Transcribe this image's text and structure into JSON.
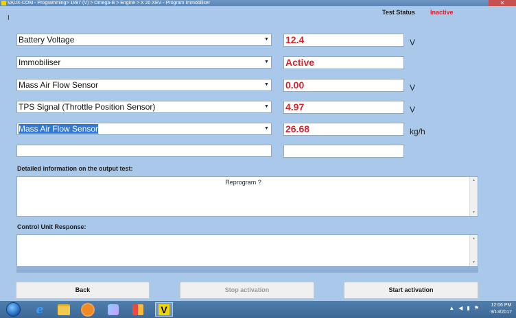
{
  "window": {
    "title": "VAUX-COM - Programming> 1997 (V) > Omega-B > Engine > X 20 XEV - Program Immobiliser",
    "close_symbol": "✕"
  },
  "status": {
    "label": "Test Status",
    "value": "Inactive",
    "color": "#e0202a"
  },
  "cursor_mark": "I",
  "measurements": [
    {
      "name": "Battery Voltage",
      "value": "12.4",
      "unit": "V"
    },
    {
      "name": "Immobiliser",
      "value": "Active",
      "unit": ""
    },
    {
      "name": "Mass Air Flow Sensor",
      "value": "0.00",
      "unit": "V"
    },
    {
      "name": "TPS Signal (Throttle Position Sensor)",
      "value": "4.97",
      "unit": "V"
    },
    {
      "name": "Mass Air Flow Sensor",
      "value": "26.68",
      "unit": "kg/h"
    },
    {
      "name": "",
      "value": "",
      "unit": ""
    }
  ],
  "detail": {
    "label": "Detailed information on the output test:",
    "text": "Reprogram ?"
  },
  "response": {
    "label": "Control Unit Response:",
    "text": ""
  },
  "buttons": {
    "back": "Back",
    "stop": "Stop activation",
    "start": "Start activation"
  },
  "taskbar": {
    "time": "12:06 PM",
    "date": "9/13/2017",
    "vaux_label": "V"
  },
  "icons": [
    "start-orb-icon",
    "internet-explorer-icon",
    "file-explorer-icon",
    "media-player-icon",
    "paint-icon",
    "office-icon",
    "vaux-com-icon",
    "speaker-icon",
    "network-icon",
    "flag-icon"
  ],
  "colors": {
    "value_red": "#d8252c",
    "background": "#a9c8ea",
    "taskbar": "#3c6896"
  }
}
